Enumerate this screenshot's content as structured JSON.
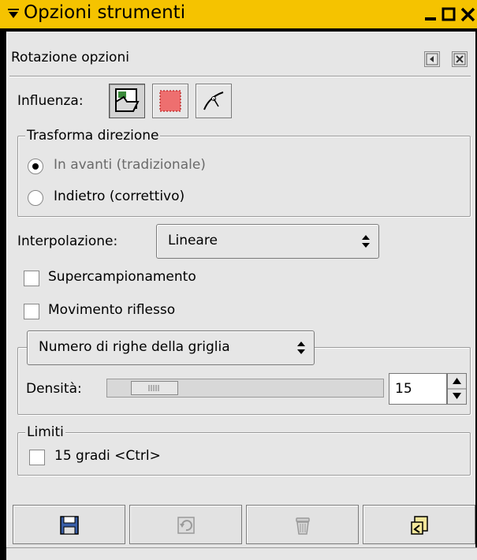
{
  "window": {
    "title": "Opzioni strumenti",
    "controls": [
      "minimize-icon",
      "maximize-icon",
      "close-icon"
    ],
    "titlebar_color": "#f5c300"
  },
  "dialog": {
    "title": "Rotazione opzioni"
  },
  "affect": {
    "label": "Influenza:",
    "buttons": [
      "layer-icon",
      "selection-icon",
      "path-icon"
    ],
    "active": "layer-icon"
  },
  "direction": {
    "legend": "Trasforma direzione",
    "forward_label": "In avanti (tradizionale)",
    "backward_label": "Indietro (correttivo)",
    "selected": "forward"
  },
  "interpolation": {
    "label": "Interpolazione:",
    "value": "Lineare"
  },
  "options": {
    "supersample_label": "Supercampionamento",
    "supersample_checked": false,
    "clip_label": "Movimento riflesso",
    "clip_checked": false
  },
  "preview": {
    "combo_value": "Numero di righe della griglia",
    "density_label": "Densità:",
    "density_value": "15"
  },
  "limits": {
    "legend": "Limiti",
    "constrain_label": "15 gradi  <Ctrl>",
    "constrain_checked": false
  },
  "bottom_buttons": [
    "save-icon",
    "restore-icon",
    "delete-icon",
    "reset-icon"
  ]
}
